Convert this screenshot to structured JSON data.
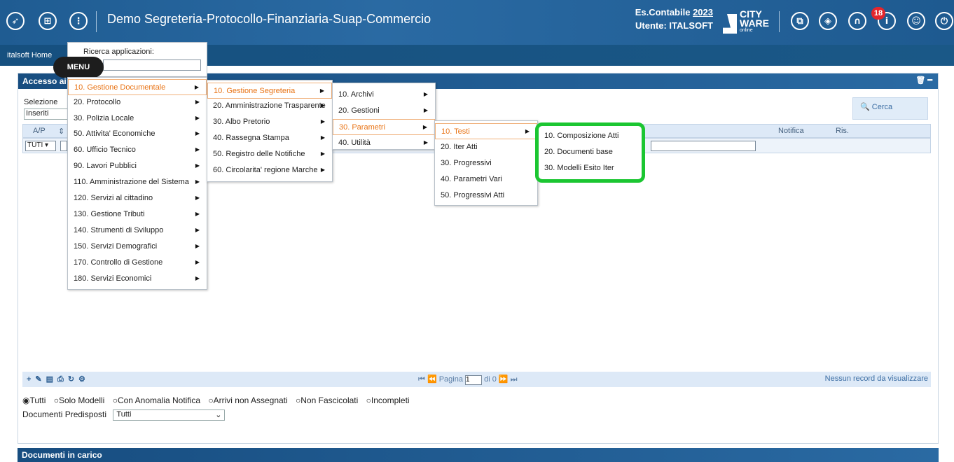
{
  "topbar": {
    "app_title": "Demo Segreteria-Protocollo-Finanziaria-Suap-Commercio",
    "es_label": "Es.Contabile",
    "es_year": "2023",
    "user_label": "Utente: ITALSOFT",
    "logo_line1": "CITY",
    "logo_line2": "WARE",
    "logo_line3": "online",
    "notifications": "18"
  },
  "navbar": {
    "home": "italsoft Home"
  },
  "menu_bubble": "MENU",
  "search_popup": {
    "label": "Ricerca applicazioni:"
  },
  "panel": {
    "title": "Accesso ai p",
    "selezione_label": "Selezione",
    "selezione_value": "Inseriti",
    "cerca": "Cerca",
    "columns": {
      "ap": "A/P",
      "notifica": "Notifica",
      "ris": "Ris."
    },
    "filter_value": "TUTI",
    "pager_label": "Pagina",
    "pager_value": "1",
    "pager_of": "di 0",
    "no_records": "Nessun record da visualizzare",
    "radios": [
      "Tutti",
      "Solo Modelli",
      "Con Anomalia Notifica",
      "Arrivi non Assegnati",
      "Non Fascicolati",
      "Incompleti"
    ],
    "docpre_label": "Documenti Predisposti",
    "docpre_value": "Tutti"
  },
  "bottom_panel": {
    "title": "Documenti in carico"
  },
  "menu_level1": [
    "10. Gestione Documentale",
    "20. Protocollo",
    "30. Polizia Locale",
    "50. Attivita' Economiche",
    "60. Ufficio Tecnico",
    "90. Lavori Pubblici",
    "110. Amministrazione del Sistema",
    "120. Servizi al cittadino",
    "130. Gestione Tributi",
    "140. Strumenti di Sviluppo",
    "150. Servizi Demografici",
    "170. Controllo di Gestione",
    "180. Servizi Economici"
  ],
  "menu_level2": [
    "10. Gestione Segreteria",
    "20. Amministrazione Trasparente",
    "30. Albo Pretorio",
    "40. Rassegna Stampa",
    "50. Registro delle Notifiche",
    "60. Circolarita' regione Marche"
  ],
  "menu_level3": [
    "10. Archivi",
    "20. Gestioni",
    "30. Parametri",
    "40. Utilità"
  ],
  "menu_level4": [
    "10. Testi",
    "20. Iter Atti",
    "30. Progressivi",
    "40. Parametri Vari",
    "50. Progressivi Atti"
  ],
  "menu_level5": [
    "10. Composizione Atti",
    "20. Documenti base",
    "30. Modelli Esito Iter"
  ],
  "colors": {
    "topbar": "#2a6aa3",
    "active_menu": "#e87314",
    "highlight": "#1bc631",
    "badge": "#e3262c"
  }
}
